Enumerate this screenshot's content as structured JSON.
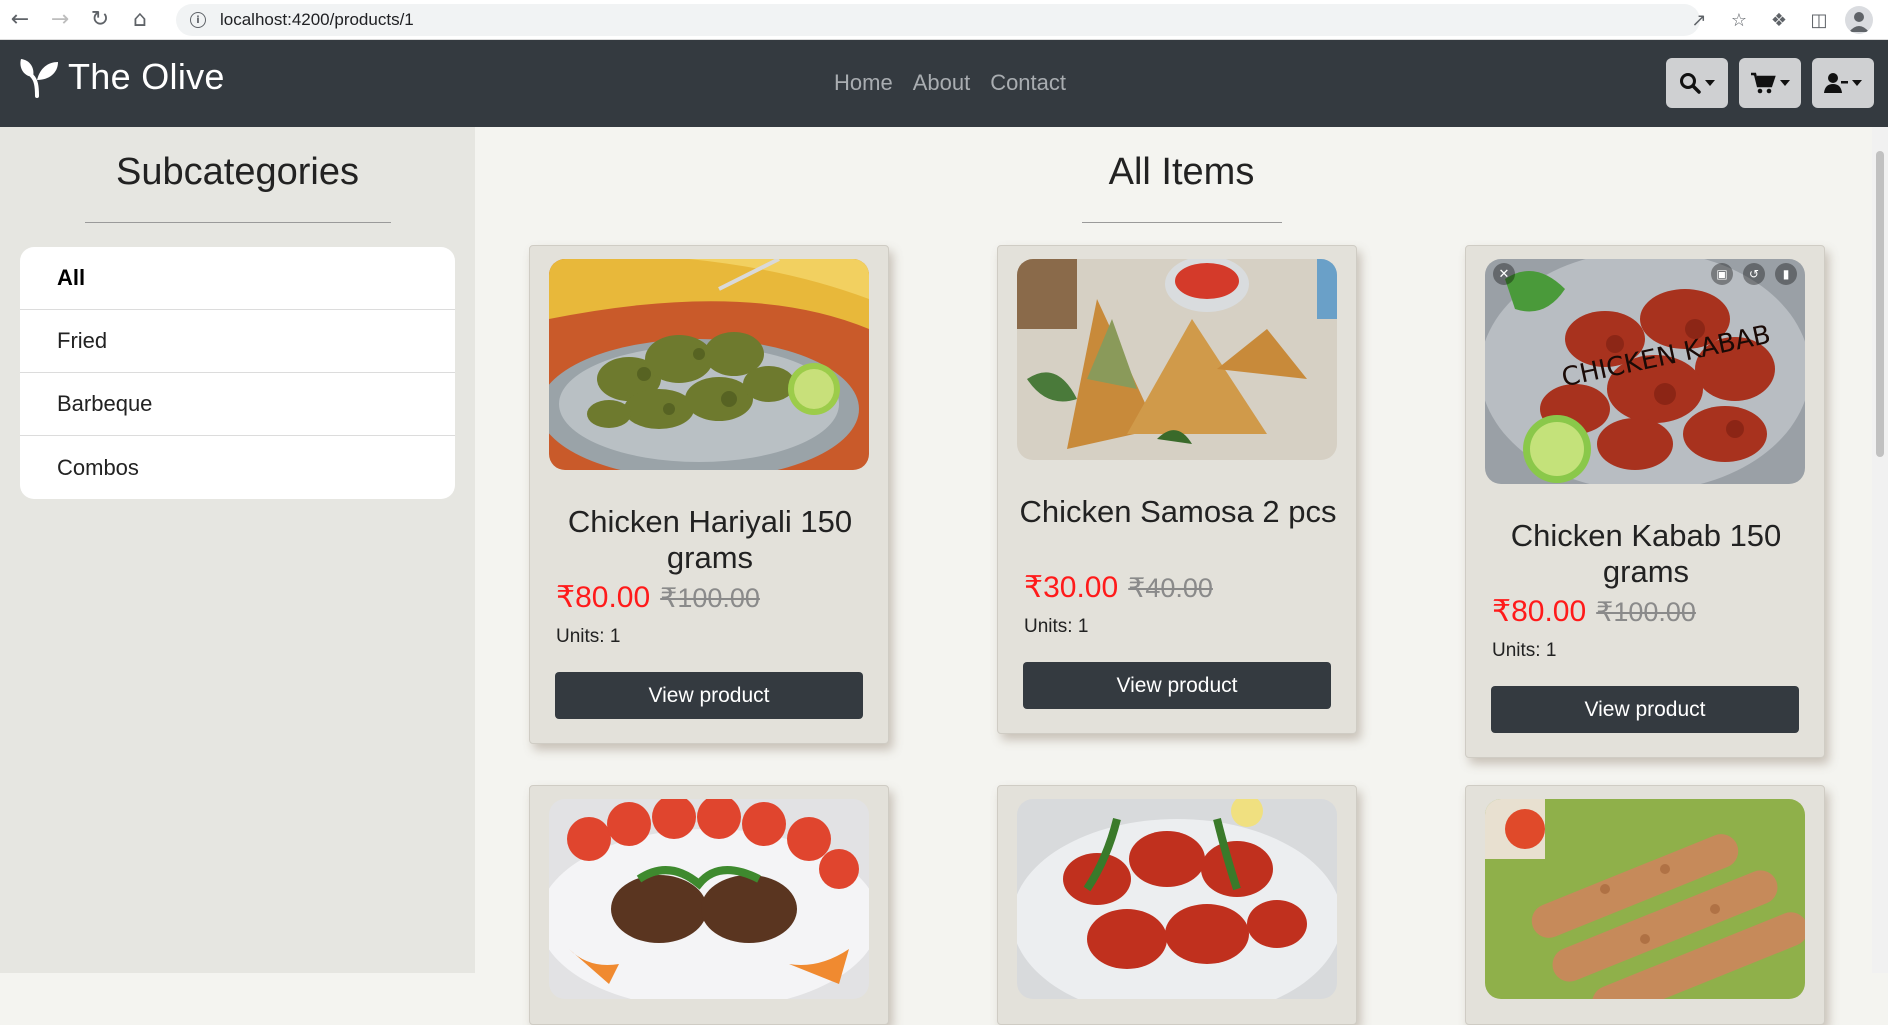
{
  "browser": {
    "url": "localhost:4200/products/1"
  },
  "brand": {
    "name": "The Olive"
  },
  "nav": {
    "links": [
      "Home",
      "About",
      "Contact"
    ]
  },
  "sidebar": {
    "title": "Subcategories",
    "items": [
      "All",
      "Fried",
      "Barbeque",
      "Combos"
    ],
    "active": "All"
  },
  "main": {
    "title": "All Items"
  },
  "products": [
    {
      "name": "Chicken Hariyali 150 grams",
      "price": "₹80.00",
      "old_price": "₹100.00",
      "units": "Units: 1",
      "button": "View product"
    },
    {
      "name": "Chicken Samosa 2 pcs",
      "price": "₹30.00",
      "old_price": "₹40.00",
      "units": "Units: 1",
      "button": "View product"
    },
    {
      "name": "Chicken Kabab 150 grams",
      "price": "₹80.00",
      "old_price": "₹100.00",
      "units": "Units: 1",
      "button": "View product",
      "image_text": "CHICKEN KABAB"
    },
    {
      "name": "",
      "price": "",
      "old_price": "",
      "units": "",
      "button": ""
    },
    {
      "name": "",
      "price": "",
      "old_price": "",
      "units": "",
      "button": ""
    },
    {
      "name": "",
      "price": "",
      "old_price": "",
      "units": "",
      "button": ""
    }
  ],
  "colors": {
    "navbar": "#343a40",
    "price": "#ff1a1a",
    "card": "#e3e1da",
    "sidebar": "#e6e6e1"
  }
}
